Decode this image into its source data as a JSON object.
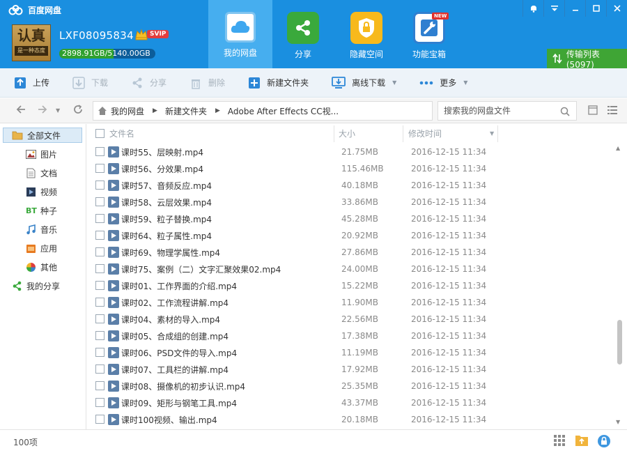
{
  "app": {
    "title": "百度网盘"
  },
  "user": {
    "avatar_text_big": "认真",
    "avatar_text_small": "是一种态度",
    "username": "LXF08095834",
    "vip_badge": "SVIP",
    "quota_used": "2898.91GB",
    "quota_separator": "/",
    "quota_total": "5140.00GB",
    "quota_used_fraction": 0.564
  },
  "nav_tabs": [
    {
      "label": "我的网盘",
      "icon": "cloud-icon",
      "active": true
    },
    {
      "label": "分享",
      "icon": "share-icon"
    },
    {
      "label": "隐藏空间",
      "icon": "lock-icon"
    },
    {
      "label": "功能宝箱",
      "icon": "wrench-icon",
      "badge": "NEW"
    }
  ],
  "window_controls": [
    "bell-icon",
    "menu-icon",
    "minimize-icon",
    "maximize-icon",
    "close-icon"
  ],
  "transfer_list": {
    "label": "传输列表(5097)"
  },
  "toolbar": {
    "upload": "上传",
    "download": "下载",
    "share": "分享",
    "delete": "删除",
    "new_folder": "新建文件夹",
    "offline_download": "离线下载",
    "more": "更多"
  },
  "breadcrumb": [
    "我的网盘",
    "新建文件夹",
    "Adobe After Effects CC视..."
  ],
  "search": {
    "placeholder": "搜索我的网盘文件"
  },
  "sidebar": [
    {
      "label": "全部文件",
      "icon": "folder-icon",
      "active": true
    },
    {
      "label": "图片",
      "icon": "image-icon"
    },
    {
      "label": "文档",
      "icon": "document-icon"
    },
    {
      "label": "视频",
      "icon": "video-icon"
    },
    {
      "label": "种子",
      "icon": "bt-icon"
    },
    {
      "label": "音乐",
      "icon": "music-icon"
    },
    {
      "label": "应用",
      "icon": "app-icon"
    },
    {
      "label": "其他",
      "icon": "other-icon"
    },
    {
      "label": "我的分享",
      "icon": "share-icon"
    }
  ],
  "columns": {
    "name": "文件名",
    "size": "大小",
    "time": "修改时间"
  },
  "files": [
    {
      "name": "课时55、层映射.mp4",
      "size": "21.75MB",
      "time": "2016-12-15 11:34"
    },
    {
      "name": "课时56、分效果.mp4",
      "size": "115.46MB",
      "time": "2016-12-15 11:34"
    },
    {
      "name": "课时57、音频反应.mp4",
      "size": "40.18MB",
      "time": "2016-12-15 11:34"
    },
    {
      "name": "课时58、云层效果.mp4",
      "size": "33.86MB",
      "time": "2016-12-15 11:34"
    },
    {
      "name": "课时59、粒子替换.mp4",
      "size": "45.28MB",
      "time": "2016-12-15 11:34"
    },
    {
      "name": "课时64、粒子属性.mp4",
      "size": "20.92MB",
      "time": "2016-12-15 11:34"
    },
    {
      "name": "课时69、物理学属性.mp4",
      "size": "27.86MB",
      "time": "2016-12-15 11:34"
    },
    {
      "name": "课时75、案例（二）文字汇聚效果02.mp4",
      "size": "24.00MB",
      "time": "2016-12-15 11:34"
    },
    {
      "name": "课时01、工作界面的介绍.mp4",
      "size": "15.22MB",
      "time": "2016-12-15 11:34"
    },
    {
      "name": "课时02、工作流程讲解.mp4",
      "size": "11.90MB",
      "time": "2016-12-15 11:34"
    },
    {
      "name": "课时04、素材的导入.mp4",
      "size": "22.56MB",
      "time": "2016-12-15 11:34"
    },
    {
      "name": "课时05、合成组的创建.mp4",
      "size": "17.38MB",
      "time": "2016-12-15 11:34"
    },
    {
      "name": "课时06、PSD文件的导入.mp4",
      "size": "11.19MB",
      "time": "2016-12-15 11:34"
    },
    {
      "name": "课时07、工具栏的讲解.mp4",
      "size": "17.92MB",
      "time": "2016-12-15 11:34"
    },
    {
      "name": "课时08、摄像机的初步认识.mp4",
      "size": "25.35MB",
      "time": "2016-12-15 11:34"
    },
    {
      "name": "课时09、矩形与钢笔工具.mp4",
      "size": "43.37MB",
      "time": "2016-12-15 11:34"
    },
    {
      "name": "课时100视频、输出.mp4",
      "size": "20.18MB",
      "time": "2016-12-15 11:34"
    }
  ],
  "status": {
    "item_count": "100项"
  },
  "scroll": {
    "position_fraction": 0.76,
    "visible_fraction": 0.17
  },
  "colors": {
    "header": "#1a8fe0",
    "active_tab": "#46aeef",
    "transfer_green": "#3fa535",
    "toolbar_bg": "#edf3f9"
  }
}
